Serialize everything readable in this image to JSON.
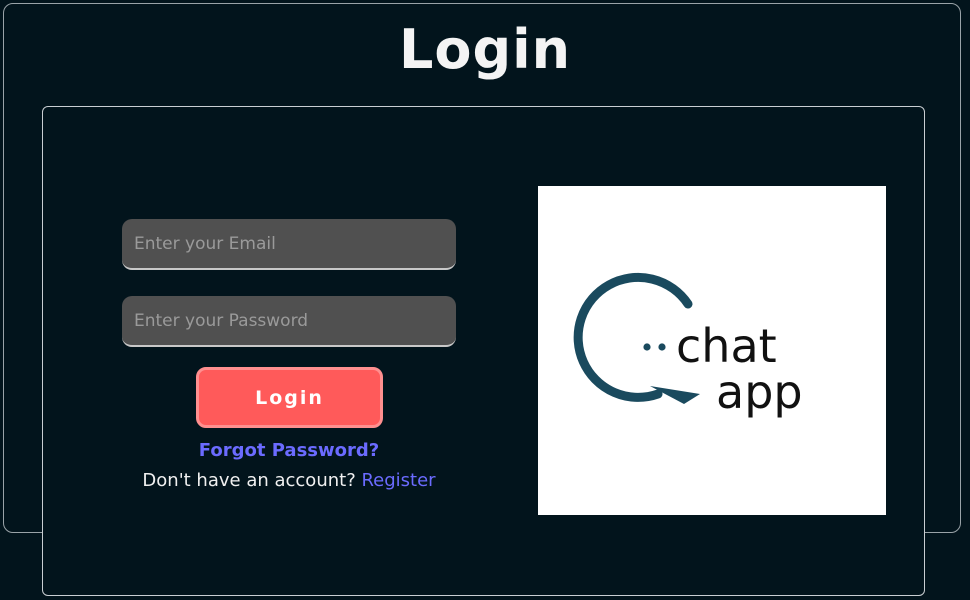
{
  "page": {
    "title": "Login"
  },
  "form": {
    "email_placeholder": "Enter your Email",
    "password_placeholder": "Enter your Password",
    "login_label": "Login",
    "forgot_label": "Forgot Password?",
    "no_account_text": "Don't have an account? ",
    "register_label": "Register"
  },
  "logo": {
    "line1": "chat",
    "line2": "app",
    "icon": "chat-bubble-icon"
  },
  "colors": {
    "background": "#02141c",
    "button": "#ff5a5a",
    "link": "#6b6bff",
    "input": "#505050",
    "logo_ring": "#1a4a5e"
  }
}
